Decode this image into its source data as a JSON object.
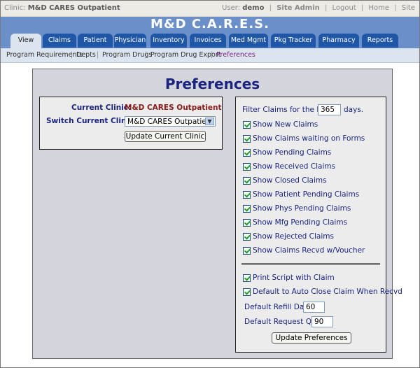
{
  "topbar": {
    "clinic_label": "Clinic:",
    "clinic_name": "M&D CARES Outpatient",
    "user_label": "User:",
    "user_name": "demo",
    "links": [
      "Site Admin",
      "Logout",
      "Home",
      "Site"
    ]
  },
  "header": {
    "title": "M&D C.A.R.E.S.",
    "tabs": [
      "View",
      "Claims",
      "Patient",
      "Physician",
      "Inventory",
      "Invoices",
      "Med Mgmt",
      "Pkg Tracker",
      "Pharmacy",
      "Reports"
    ],
    "active_tab": "View"
  },
  "subnav": {
    "items": [
      "Program Requirements",
      "Depts",
      "Program Drugs",
      "Program Drug Export",
      "Preferences"
    ],
    "active": "Preferences"
  },
  "page": {
    "title": "Preferences",
    "clinic_box": {
      "current_label": "Current Clinic:",
      "current_value": "M&D CARES Outpatient",
      "switch_label": "Switch Current Clinic:",
      "switch_value": "M&D CARES Outpatient",
      "update_button": "Update Current Clinic"
    },
    "prefs": {
      "filter_prefix": "Filter Claims for the last",
      "filter_days_value": "365",
      "filter_suffix": "days.",
      "checkboxes": [
        {
          "label": "Show New Claims",
          "checked": true
        },
        {
          "label": "Show Claims waiting on Forms",
          "checked": true
        },
        {
          "label": "Show Pending Claims",
          "checked": true
        },
        {
          "label": "Show Received Claims",
          "checked": true
        },
        {
          "label": "Show Closed Claims",
          "checked": true
        },
        {
          "label": "Show Patient Pending Claims",
          "checked": true
        },
        {
          "label": "Show Phys Pending Claims",
          "checked": true
        },
        {
          "label": "Show Mfg Pending Claims",
          "checked": true
        },
        {
          "label": "Show Rejected Claims",
          "checked": true
        },
        {
          "label": "Show Claims Recvd w/Voucher",
          "checked": true
        }
      ],
      "print_script": {
        "label": "Print Script with Claim",
        "checked": true
      },
      "auto_close": {
        "label": "Default to Auto Close Claim When Recvd",
        "checked": true
      },
      "refill_label": "Default Refill Days:",
      "refill_value": "60",
      "request_label": "Default Request Qty:",
      "request_value": "90",
      "update_button": "Update Preferences"
    }
  }
}
